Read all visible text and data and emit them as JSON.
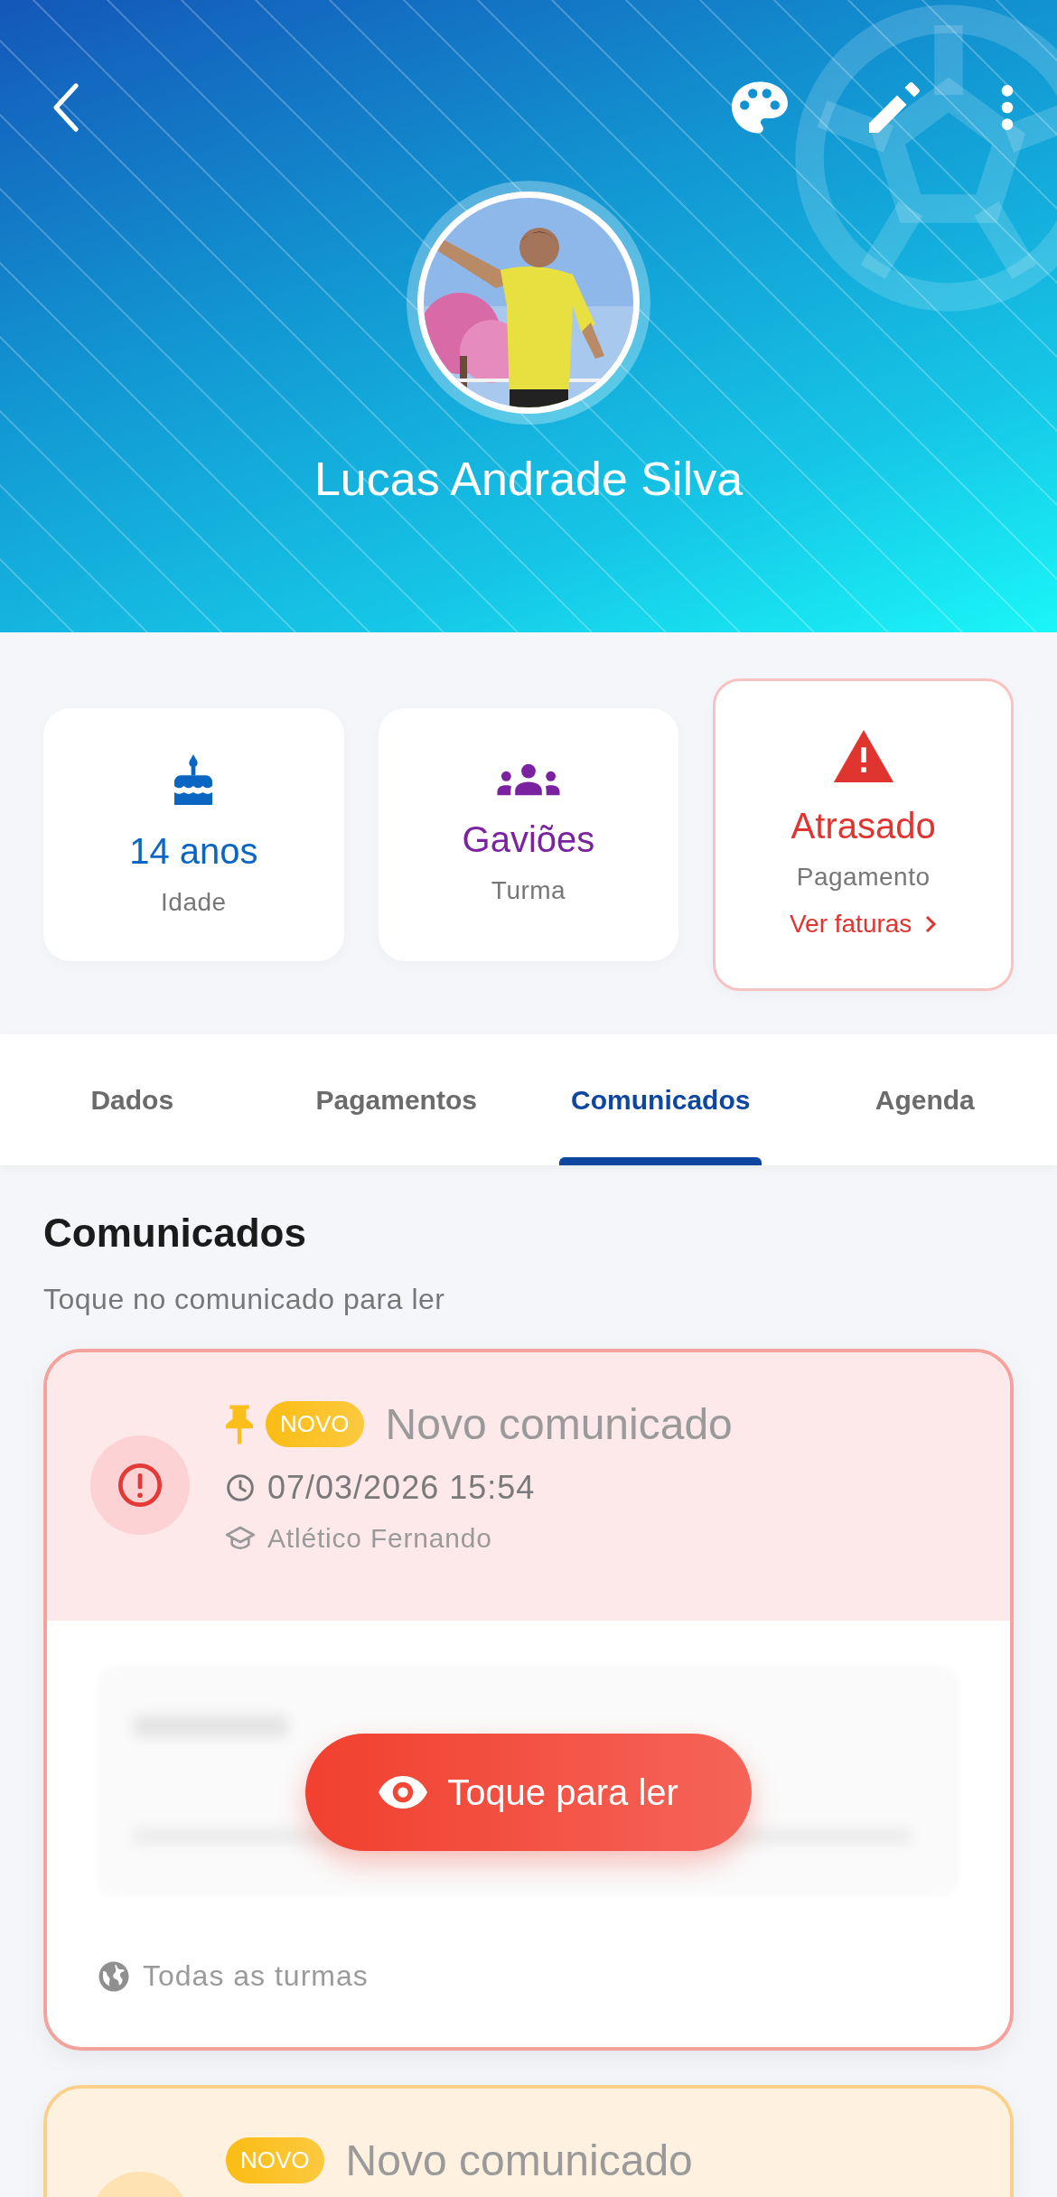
{
  "header": {
    "name": "Lucas Andrade Silva"
  },
  "stats": [
    {
      "kind": "age",
      "value": "14 anos",
      "label": "Idade"
    },
    {
      "kind": "class",
      "value": "Gaviões",
      "label": "Turma"
    },
    {
      "kind": "payment",
      "value": "Atrasado",
      "label": "Pagamento",
      "link": "Ver faturas"
    }
  ],
  "tabs": [
    {
      "label": "Dados",
      "selected": false
    },
    {
      "label": "Pagamentos",
      "selected": false
    },
    {
      "label": "Comunicados",
      "selected": true
    },
    {
      "label": "Agenda",
      "selected": false
    }
  ],
  "section": {
    "title": "Comunicados",
    "subtitle": "Toque no comunicado para ler"
  },
  "announcements": [
    {
      "kind": "urgent",
      "pinned": true,
      "badge": "NOVO",
      "title": "Novo comunicado",
      "datetime": "07/03/2026 15:54",
      "author": "Atlético Fernando",
      "action": "Toque para ler",
      "audience": "Todas as turmas"
    },
    {
      "kind": "warning",
      "pinned": false,
      "badge": "NOVO",
      "title": "Novo comunicado"
    }
  ]
}
